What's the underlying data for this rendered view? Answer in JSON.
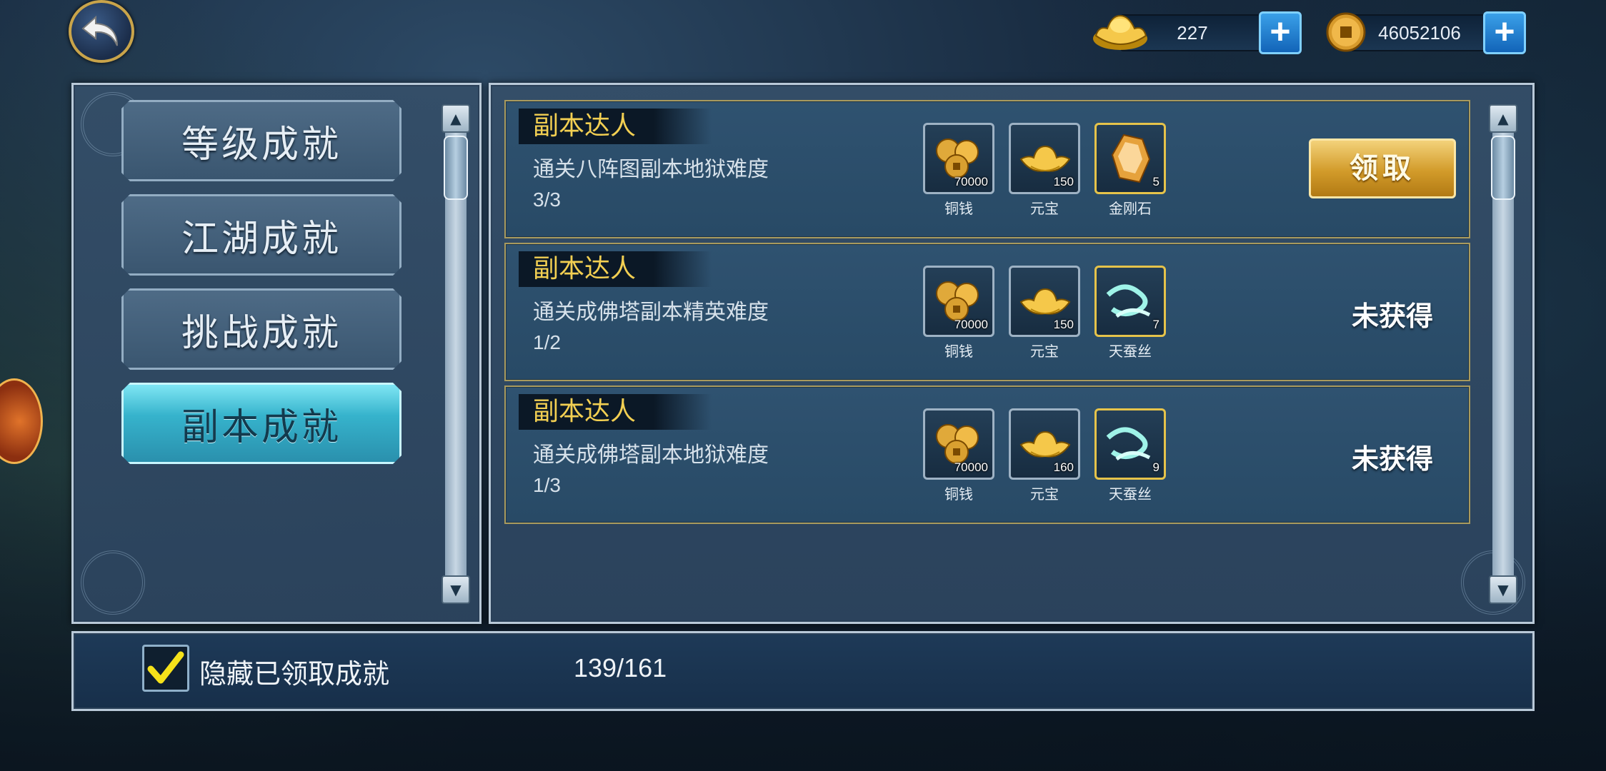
{
  "currency": {
    "gold_ingot": "227",
    "copper_coin": "46052106"
  },
  "tabs": [
    {
      "label": "等级成就",
      "active": false
    },
    {
      "label": "江湖成就",
      "active": false
    },
    {
      "label": "挑战成就",
      "active": false
    },
    {
      "label": "副本成就",
      "active": true
    }
  ],
  "achievements": [
    {
      "title": "副本达人",
      "description": "通关八阵图副本地狱难度",
      "progress": "3/3",
      "rewards": [
        {
          "icon": "copper-coins-icon",
          "count": "70000",
          "name": "铜钱"
        },
        {
          "icon": "gold-ingot-icon",
          "count": "150",
          "name": "元宝"
        },
        {
          "icon": "diamond-stone-icon",
          "count": "5",
          "name": "金刚石"
        }
      ],
      "action": "领取"
    },
    {
      "title": "副本达人",
      "description": "通关成佛塔副本精英难度",
      "progress": "1/2",
      "rewards": [
        {
          "icon": "copper-coins-icon",
          "count": "70000",
          "name": "铜钱"
        },
        {
          "icon": "gold-ingot-icon",
          "count": "150",
          "name": "元宝"
        },
        {
          "icon": "silk-thread-icon",
          "count": "7",
          "name": "天蚕丝"
        }
      ],
      "status": "未获得"
    },
    {
      "title": "副本达人",
      "description": "通关成佛塔副本地狱难度",
      "progress": "1/3",
      "rewards": [
        {
          "icon": "copper-coins-icon",
          "count": "70000",
          "name": "铜钱"
        },
        {
          "icon": "gold-ingot-icon",
          "count": "160",
          "name": "元宝"
        },
        {
          "icon": "silk-thread-icon",
          "count": "9",
          "name": "天蚕丝"
        }
      ],
      "status": "未获得"
    }
  ],
  "footer": {
    "hide_claimed_label": "隐藏已领取成就",
    "hide_claimed_checked": true,
    "count": "139/161"
  },
  "colors": {
    "title_gold": "#f2cf52",
    "active_tab": "#36b3cc",
    "claim_button": "#d29b2a"
  }
}
